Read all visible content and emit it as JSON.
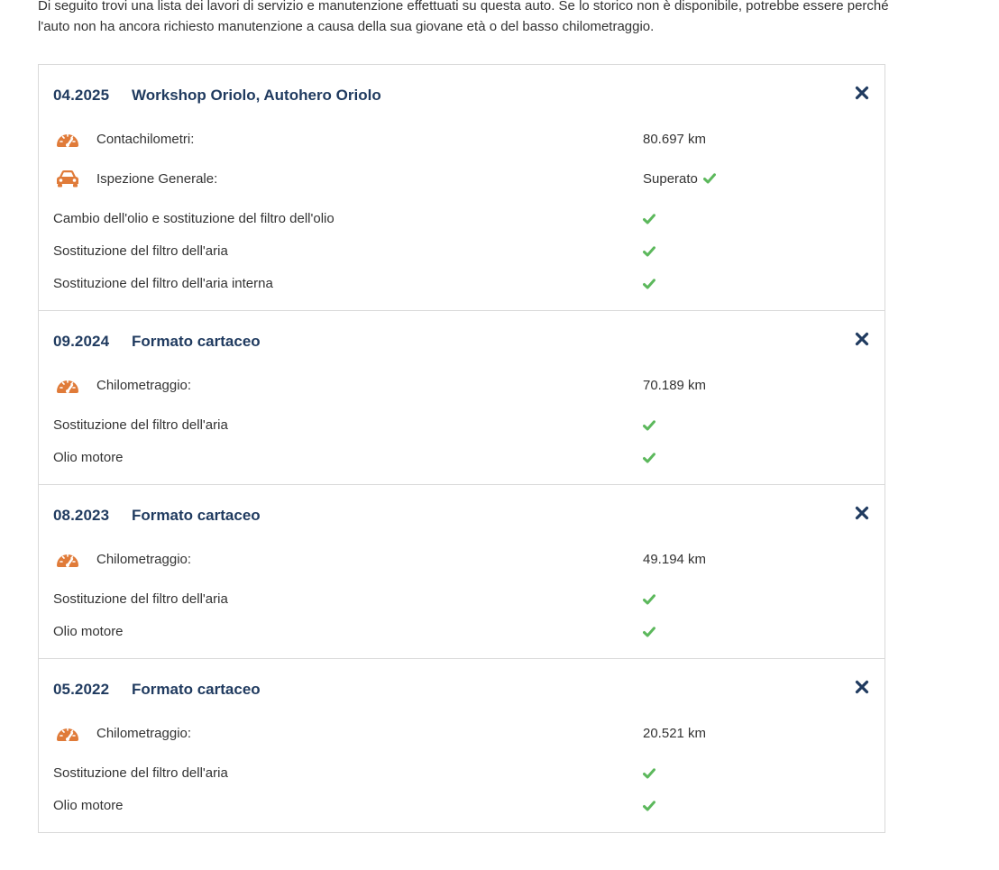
{
  "intro": {
    "text": "Di seguito trovi una lista dei lavori di servizio e manutenzione effettuati su questa auto. Se lo storico non è disponibile, potrebbe essere perché l'auto non ha ancora richiesto manutenzione a causa della sua giovane età o del basso chilometraggio."
  },
  "colors": {
    "heading": "#1f3a5f",
    "icon_orange": "#e07b39",
    "check_green": "#5cb85c",
    "border": "#d9d9d9"
  },
  "entries": [
    {
      "date": "04.2025",
      "title": "Workshop Oriolo, Autohero Oriolo",
      "mileage_label": "Contachilometri:",
      "mileage_value": "80.697 km",
      "inspection_label": "Ispezione Generale:",
      "inspection_value": "Superato",
      "tasks": [
        "Cambio dell'olio e sostituzione del filtro dell'olio",
        "Sostituzione del filtro dell'aria",
        "Sostituzione del filtro dell'aria interna"
      ]
    },
    {
      "date": "09.2024",
      "title": "Formato cartaceo",
      "mileage_label": "Chilometraggio:",
      "mileage_value": "70.189 km",
      "tasks": [
        "Sostituzione del filtro dell'aria",
        "Olio motore"
      ]
    },
    {
      "date": "08.2023",
      "title": "Formato cartaceo",
      "mileage_label": "Chilometraggio:",
      "mileage_value": "49.194 km",
      "tasks": [
        "Sostituzione del filtro dell'aria",
        "Olio motore"
      ]
    },
    {
      "date": "05.2022",
      "title": "Formato cartaceo",
      "mileage_label": "Chilometraggio:",
      "mileage_value": "20.521 km",
      "tasks": [
        "Sostituzione del filtro dell'aria",
        "Olio motore"
      ]
    }
  ],
  "icons": {
    "mileage": "speedometer-icon",
    "inspection": "car-icon",
    "done": "check-icon",
    "close": "close-icon"
  }
}
